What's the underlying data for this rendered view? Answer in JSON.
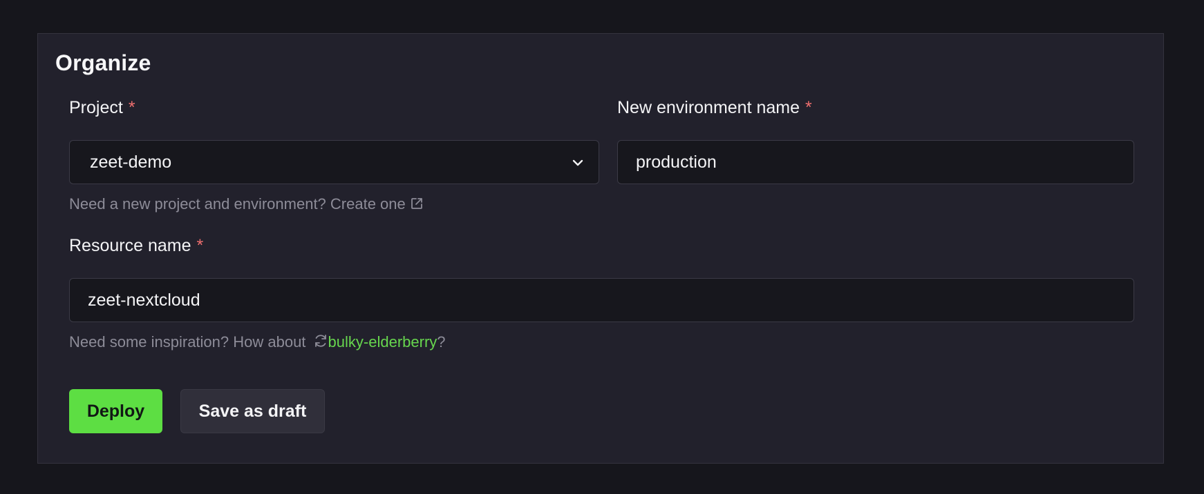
{
  "section": {
    "title": "Organize"
  },
  "project": {
    "label": "Project",
    "required_mark": "*",
    "selected_value": "zeet-demo",
    "helper_text": "Need a new project and environment? Create one"
  },
  "environment": {
    "label": "New environment name",
    "required_mark": "*",
    "value": "production"
  },
  "resource": {
    "label": "Resource name",
    "required_mark": "*",
    "value": "zeet-nextcloud",
    "helper_prefix": "Need some inspiration? How about",
    "suggestion": "bulky-elderberry",
    "helper_suffix": "?"
  },
  "actions": {
    "deploy_label": "Deploy",
    "draft_label": "Save as draft"
  },
  "colors": {
    "accent_green": "#5dde43",
    "required_red": "#ef6f6f",
    "background": "#16161c",
    "card": "#22212c"
  },
  "icons": {
    "project_dropdown": "chevron-down-icon",
    "create_link": "external-link-icon",
    "refresh_suggestion": "refresh-icon"
  }
}
